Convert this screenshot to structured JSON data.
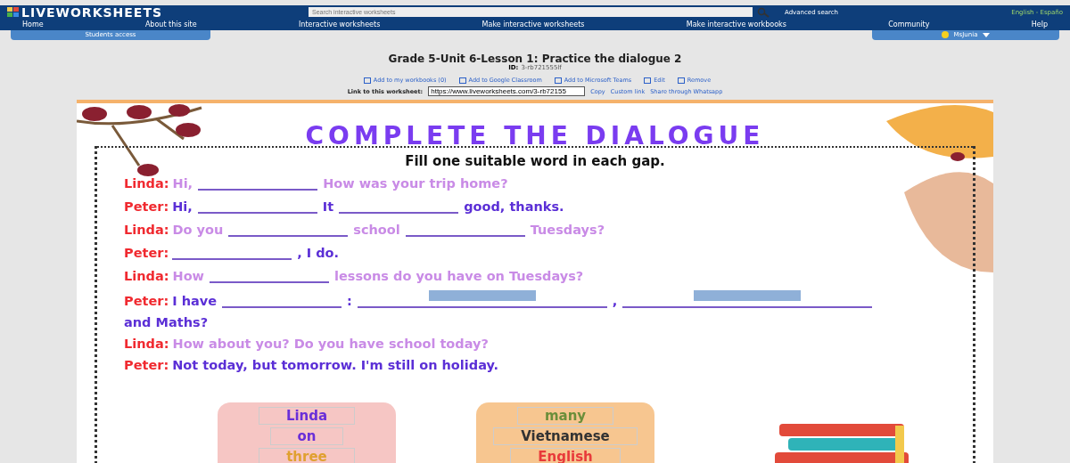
{
  "header": {
    "logo": "LIVEWORKSHEETS",
    "search": {
      "placeholder": "Search interactive worksheets"
    },
    "advanced_search": "Advanced search",
    "languages": "English - Españo"
  },
  "nav": [
    "Home",
    "About this site",
    "Interactive worksheets",
    "Make interactive worksheets",
    "Make interactive workbooks",
    "Community",
    "Help"
  ],
  "students_access": "Students access",
  "user": "MsJunia",
  "worksheet_info": {
    "title": "Grade 5-Unit 6-Lesson 1: Practice the dialogue 2",
    "id_label": "ID:",
    "id": "3-rb721555lf",
    "actions": [
      "Add to my workbooks (0)",
      "Add to Google Classroom",
      "Add to Microsoft Teams",
      "Edit",
      "Remove"
    ],
    "link_label": "Link to this worksheet:",
    "link": "https://www.liveworksheets.com/3-rb72155",
    "link_actions": [
      "Copy",
      "Custom link",
      "Share through Whatsapp"
    ]
  },
  "worksheet": {
    "heading": "COMPLETE THE DIALOGUE",
    "instruction": "Fill one suitable word in each gap.",
    "lines": [
      {
        "speaker": "Linda:",
        "color": "#c98be6",
        "parts": [
          {
            "kind": "text",
            "text": "Hi,"
          },
          {
            "kind": "gap"
          },
          {
            "kind": "text",
            "text": "How was your trip home?"
          }
        ]
      },
      {
        "speaker": "Peter:",
        "color": "#5b2fd6",
        "parts": [
          {
            "kind": "text",
            "text": "Hi,"
          },
          {
            "kind": "gap"
          },
          {
            "kind": "text",
            "text": "It"
          },
          {
            "kind": "gap"
          },
          {
            "kind": "text",
            "text": "good, thanks."
          }
        ]
      },
      {
        "speaker": "Linda:",
        "color": "#c98be6",
        "parts": [
          {
            "kind": "text",
            "text": "Do you"
          },
          {
            "kind": "gap"
          },
          {
            "kind": "text",
            "text": "school"
          },
          {
            "kind": "gap"
          },
          {
            "kind": "text",
            "text": "Tuesdays?"
          }
        ]
      },
      {
        "speaker": "Peter:",
        "color": "#5b2fd6",
        "parts": [
          {
            "kind": "gap"
          },
          {
            "kind": "text",
            "text": ", I do."
          }
        ]
      },
      {
        "speaker": "Linda:",
        "color": "#c98be6",
        "parts": [
          {
            "kind": "text",
            "text": "How"
          },
          {
            "kind": "gap"
          },
          {
            "kind": "text",
            "text": "lessons do you have on Tuesdays?"
          }
        ]
      },
      {
        "speaker": "Peter:",
        "color": "#5b2fd6",
        "parts": [
          {
            "kind": "text",
            "text": "I have"
          },
          {
            "kind": "gap"
          },
          {
            "kind": "text",
            "text": ":"
          },
          {
            "kind": "picture-gap"
          },
          {
            "kind": "text",
            "text": ","
          },
          {
            "kind": "picture-gap"
          },
          {
            "kind": "text",
            "text": "and Maths?"
          }
        ]
      },
      {
        "speaker": "Linda:",
        "color": "#c98be6",
        "parts": [
          {
            "kind": "text",
            "text": "How about you? Do you have school today?"
          }
        ]
      },
      {
        "speaker": "Peter:",
        "color": "#5b2fd6",
        "parts": [
          {
            "kind": "text",
            "text": "Not today, but tomorrow. I'm still on holiday."
          }
        ]
      }
    ],
    "word_boxes": [
      {
        "color": "#f6c6c4",
        "words": [
          {
            "text": "Linda",
            "color": "#6a2fd8"
          },
          {
            "text": "on",
            "color": "#6a2fd8"
          },
          {
            "text": "three",
            "color": "#e0a030"
          }
        ]
      },
      {
        "color": "#f7c690",
        "words": [
          {
            "text": "many",
            "color": "#6b8e3a"
          },
          {
            "text": "Vietnamese",
            "color": "#333333"
          },
          {
            "text": "English",
            "color": "#e83a3a"
          }
        ]
      }
    ]
  }
}
